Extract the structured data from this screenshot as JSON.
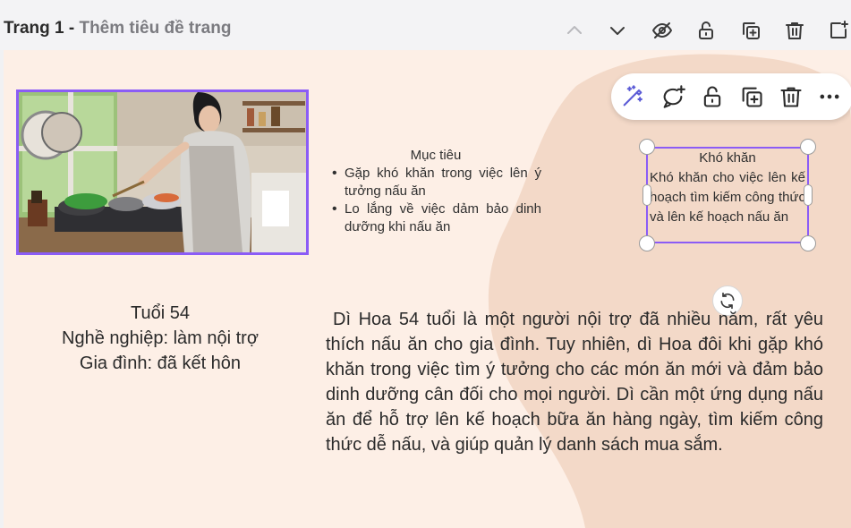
{
  "page_header": {
    "page_number": "Trang 1",
    "separator": " - ",
    "title_placeholder": "Thêm tiêu đề trang"
  },
  "page_actions": [
    "chevron-up-icon",
    "chevron-down-icon",
    "eye-off-icon",
    "unlock-icon",
    "duplicate-icon",
    "trash-icon",
    "add-page-icon"
  ],
  "floating_toolbar": [
    "magic-edit-icon",
    "comment-add-icon",
    "unlock-icon",
    "duplicate-icon",
    "trash-icon",
    "more-icon"
  ],
  "goals": {
    "title": "Mục tiêu",
    "items": [
      "Gặp khó khăn trong việc lên ý tưởng nấu ăn",
      "Lo lắng về việc dảm bảo dinh dưỡng khi nấu ăn"
    ]
  },
  "difficulties": {
    "title": "Khó khăn",
    "body": "Khó khăn cho việc lên kế hoạch tìm kiếm công thức và lên kế hoạch nấu ăn"
  },
  "profile": {
    "age": "Tuổi 54",
    "job": "Nghề nghiệp: làm nội trợ",
    "family": "Gia đình: đã kết hôn"
  },
  "description": "Dì Hoa 54 tuổi là một người nội trợ đã nhiều năm, rất yêu thích nấu ăn cho gia đình. Tuy nhiên, dì Hoa đôi khi gặp khó khăn trong việc tìm ý tưởng cho các món ăn mới và đảm bảo dinh dưỡng cân đối cho mọi người. Dì cần một ứng dụng nấu ăn để hỗ trợ lên kế hoạch bữa ăn hàng ngày, tìm kiếm công thức dễ nấu, và giúp quản lý danh sách mua sắm.",
  "colors": {
    "selection": "#8b5cf6",
    "canvas": "#fdefe6",
    "blob": "#f3d9c8",
    "text": "#2a2a2a"
  }
}
